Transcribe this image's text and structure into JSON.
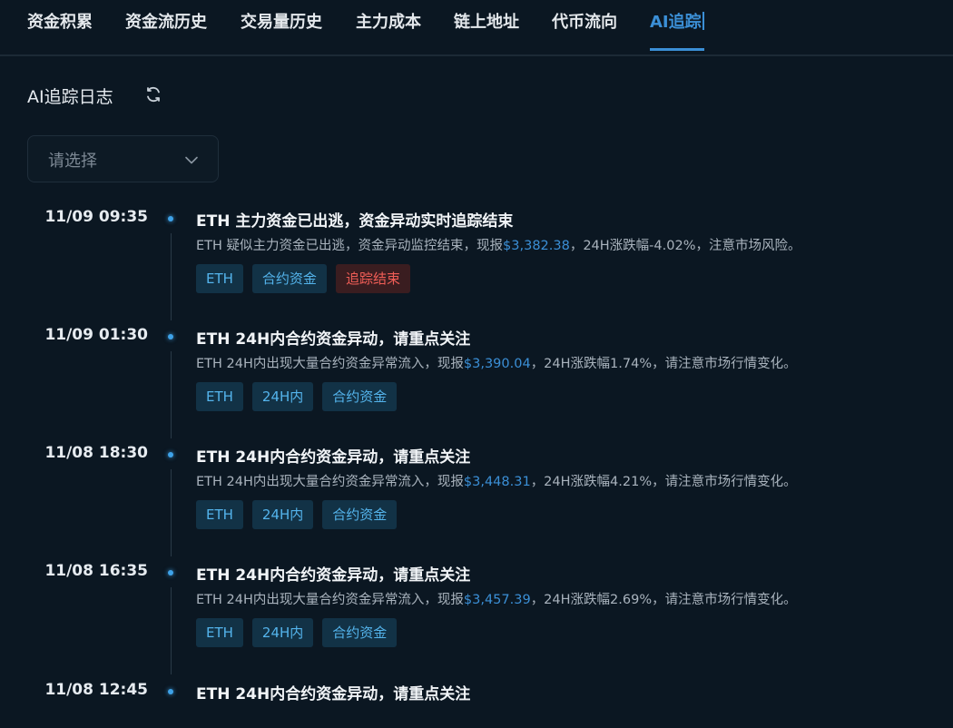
{
  "tabs": [
    {
      "label": "资金积累"
    },
    {
      "label": "资金流历史"
    },
    {
      "label": "交易量历史"
    },
    {
      "label": "主力成本"
    },
    {
      "label": "链上地址"
    },
    {
      "label": "代币流向"
    },
    {
      "label": "AI追踪",
      "active": true
    }
  ],
  "section": {
    "title": "AI追踪日志"
  },
  "filter": {
    "placeholder": "请选择"
  },
  "colors": {
    "accent": "#3b8fd6",
    "background": "#0b1722",
    "tag_bg": "#123246",
    "tag_warn": "#ef5d56"
  },
  "entries": [
    {
      "time": "11/09 09:35",
      "title": "ETH 主力资金已出逃，资金异动实时追踪结束",
      "desc_prefix": "ETH 疑似主力资金已出逃，资金异动监控结束，现报",
      "price": "$3,382.38",
      "desc_suffix": "，24H涨跌幅-4.02%，注意市场风险。",
      "tags": [
        "ETH",
        "合约资金",
        "追踪结束"
      ]
    },
    {
      "time": "11/09 01:30",
      "title": "ETH 24H内合约资金异动，请重点关注",
      "desc_prefix": "ETH 24H内出现大量合约资金异常流入，现报",
      "price": "$3,390.04",
      "desc_suffix": "，24H涨跌幅1.74%，请注意市场行情变化。",
      "tags": [
        "ETH",
        "24H内",
        "合约资金"
      ]
    },
    {
      "time": "11/08 18:30",
      "title": "ETH 24H内合约资金异动，请重点关注",
      "desc_prefix": "ETH 24H内出现大量合约资金异常流入，现报",
      "price": "$3,448.31",
      "desc_suffix": "，24H涨跌幅4.21%，请注意市场行情变化。",
      "tags": [
        "ETH",
        "24H内",
        "合约资金"
      ]
    },
    {
      "time": "11/08 16:35",
      "title": "ETH 24H内合约资金异动，请重点关注",
      "desc_prefix": "ETH 24H内出现大量合约资金异常流入，现报",
      "price": "$3,457.39",
      "desc_suffix": "，24H涨跌幅2.69%，请注意市场行情变化。",
      "tags": [
        "ETH",
        "24H内",
        "合约资金"
      ]
    },
    {
      "time": "11/08 12:45",
      "title": "ETH 24H内合约资金异动，请重点关注"
    }
  ]
}
